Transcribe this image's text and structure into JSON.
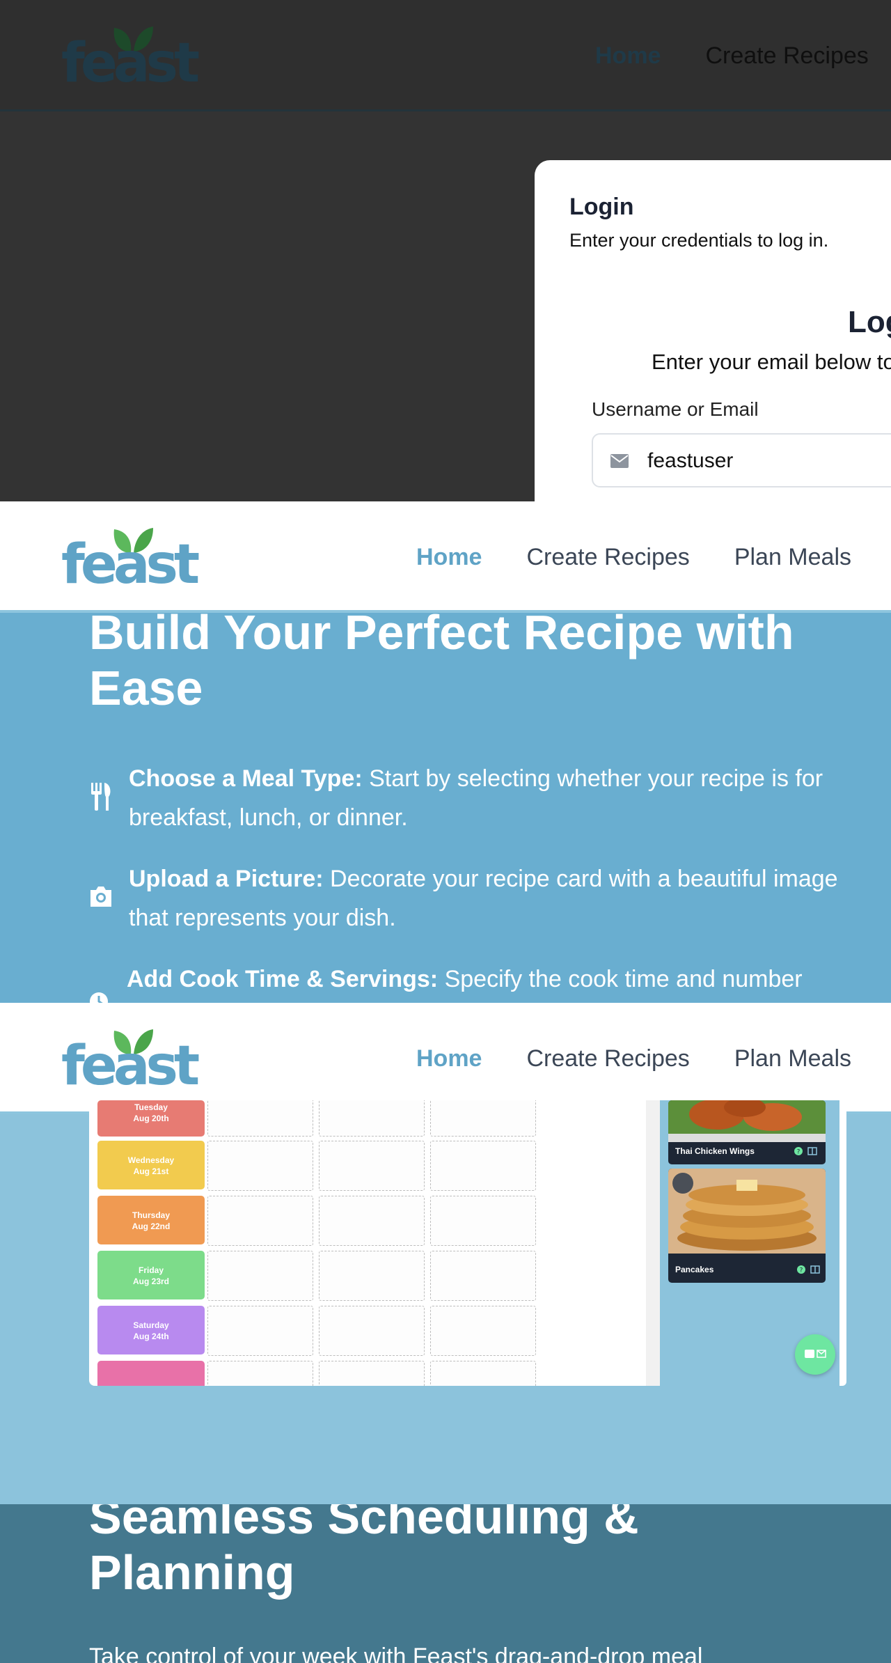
{
  "brand": {
    "logo_text": "feast",
    "accent": "#5fa3c6"
  },
  "nav": {
    "home": "Home",
    "create_recipes": "Create Recipes",
    "plan_meals": "Plan Meals"
  },
  "login_modal": {
    "title": "Login",
    "description": "Enter your credentials to log in.",
    "form_title": "Login",
    "form_description": "Enter your email below to login to your account",
    "username_label": "Username or Email",
    "username_value": "feastuser"
  },
  "recipe_section": {
    "title": "Build Your Perfect Recipe with Ease",
    "features": [
      {
        "icon": "utensils-icon",
        "heading": "Choose a Meal Type:",
        "text": " Start by selecting whether your recipe is for breakfast, lunch, or dinner."
      },
      {
        "icon": "camera-icon",
        "heading": "Upload a Picture:",
        "text": " Decorate your recipe card with a beautiful image that represents your dish."
      },
      {
        "icon": "clock-icon",
        "heading": "Add Cook Time & Servings:",
        "text": " Specify the cook time and number"
      }
    ]
  },
  "planner": {
    "days": [
      {
        "name": "Tuesday",
        "date": "Aug 20th",
        "color": "#e77b73"
      },
      {
        "name": "Wednesday",
        "date": "Aug 21st",
        "color": "#f2cb4e"
      },
      {
        "name": "Thursday",
        "date": "Aug 22nd",
        "color": "#f09a52"
      },
      {
        "name": "Friday",
        "date": "Aug 23rd",
        "color": "#7ddc8a"
      },
      {
        "name": "Saturday",
        "date": "Aug 24th",
        "color": "#b88aef"
      }
    ],
    "recipes": [
      {
        "name": "Thai Chicken Wings"
      },
      {
        "name": "Pancakes"
      }
    ]
  },
  "schedule_section": {
    "title": "Seamless Scheduling & Planning",
    "text": "Take control of your week with Feast's drag-and-drop meal"
  }
}
